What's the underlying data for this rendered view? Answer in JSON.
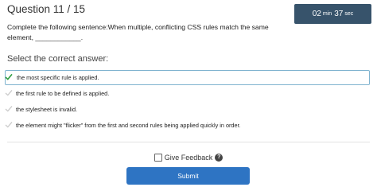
{
  "question": {
    "header": "Question 11 / 15",
    "prompt": "Complete the following sentence:When multiple, conflicting CSS rules match the same element, ____________."
  },
  "timer": {
    "minutes": "02",
    "min_unit": "min",
    "seconds": "37",
    "sec_unit": "sec"
  },
  "select_label": "Select the correct answer:",
  "options": [
    {
      "label": "the most specific rule is applied.",
      "selected": true
    },
    {
      "label": "the first rule to be defined is applied.",
      "selected": false
    },
    {
      "label": "the stylesheet is invalid.",
      "selected": false
    },
    {
      "label": "the element might \"flicker\" from the first and second rules being applied quickly in order.",
      "selected": false
    }
  ],
  "feedback": {
    "label": "Give Feedback",
    "checked": false,
    "icon": "help-circle-icon"
  },
  "submit_label": "Submit",
  "colors": {
    "timer_bg": "#37536b",
    "submit_bg": "#2e74c3",
    "check_selected": "#2e9d3f",
    "check_unselected": "#cccccc",
    "selected_border": "#7fb3cf"
  }
}
